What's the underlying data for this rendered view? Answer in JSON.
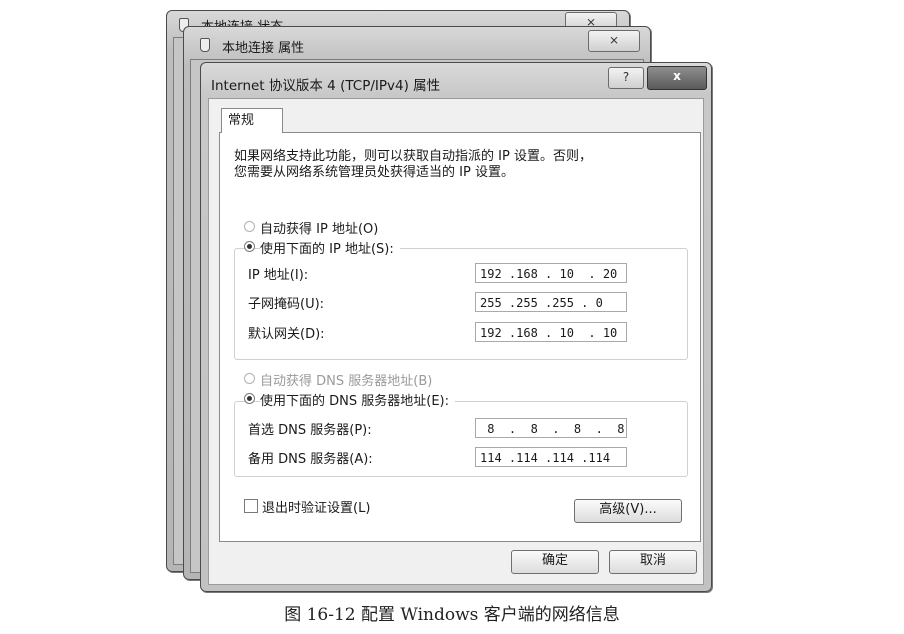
{
  "back_window": {
    "title": "本地连接 状态",
    "close_label": "⨯"
  },
  "mid_window": {
    "title": "本地连接 属性",
    "close_label": "⨯"
  },
  "dialog": {
    "title": "Internet 协议版本 4 (TCP/IPv4) 属性",
    "help_label": "?",
    "close_label": "x",
    "tab": "常规",
    "description_line1": "如果网络支持此功能，则可以获取自动指派的 IP 设置。否则，",
    "description_line2": "您需要从网络系统管理员处获得适当的 IP 设置。",
    "ip_auto_label": "自动获得 IP 地址(O)",
    "ip_manual_label": "使用下面的 IP 地址(S):",
    "ip_auto_selected": false,
    "fields": {
      "ip_label": "IP 地址(I):",
      "ip_value": "192 .168 . 10  . 20",
      "mask_label": "子网掩码(U):",
      "mask_value": "255 .255 .255 . 0",
      "gateway_label": "默认网关(D):",
      "gateway_value": "192 .168 . 10  . 10"
    },
    "dns_auto_label": "自动获得 DNS 服务器地址(B)",
    "dns_manual_label": "使用下面的 DNS 服务器地址(E):",
    "dns": {
      "preferred_label": "首选 DNS 服务器(P):",
      "preferred_value": " 8  .  8  .  8  .  8",
      "alternate_label": "备用 DNS 服务器(A):",
      "alternate_value": "114 .114 .114 .114"
    },
    "validate_label": "退出时验证设置(L)",
    "validate_checked": false,
    "advanced_label": "高级(V)...",
    "ok_label": "确定",
    "cancel_label": "取消"
  },
  "caption": "图 16-12   配置 Windows 客户端的网络信息"
}
